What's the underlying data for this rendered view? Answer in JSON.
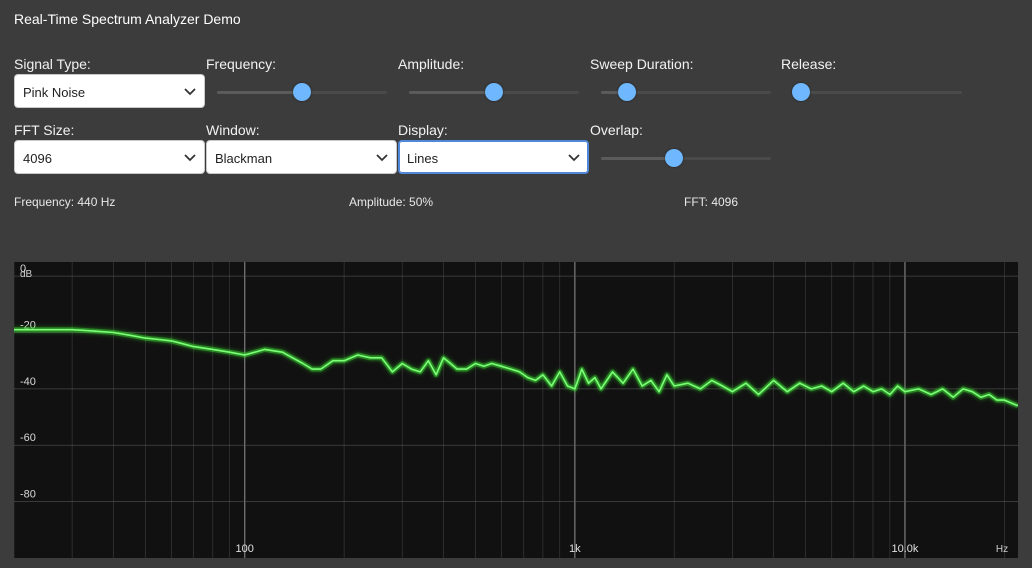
{
  "app": {
    "title": "Real-Time Spectrum Analyzer Demo"
  },
  "controls": {
    "signal_type": {
      "label": "Signal Type:",
      "value": "Pink Noise",
      "icon": "chevron-down-icon"
    },
    "frequency": {
      "label": "Frequency:",
      "level": 0.5
    },
    "amplitude": {
      "label": "Amplitude:",
      "level": 0.5
    },
    "sweep_duration": {
      "label": "Sweep Duration:",
      "level": 0.15
    },
    "release": {
      "label": "Release:",
      "level": 0.05
    },
    "fft_size": {
      "label": "FFT Size:",
      "value": "4096",
      "icon": "chevron-down-icon"
    },
    "window": {
      "label": "Window:",
      "value": "Blackman",
      "icon": "chevron-down-icon"
    },
    "display": {
      "label": "Display:",
      "value": "Lines",
      "icon": "chevron-down-icon"
    },
    "overlap": {
      "label": "Overlap:",
      "level": 0.43
    }
  },
  "status": {
    "frequency": "Frequency: 440 Hz",
    "amplitude": "Amplitude: 50%",
    "fft": "FFT: 4096"
  },
  "colors": {
    "background": "#3c3c3c",
    "plot_background": "#111111",
    "slider_thumb": "#6fb7ff",
    "spectrum_line": "#7dff7a",
    "grid": "#5a5a5a",
    "focus": "#4f87d9"
  },
  "chart_data": {
    "type": "line",
    "xscale": "log",
    "xlabel": "Hz",
    "ylabel": "dB",
    "xlim": [
      20,
      22000
    ],
    "ylim": [
      -100,
      5
    ],
    "yticks": [
      0,
      -20,
      -40,
      -60,
      -80
    ],
    "ytick_labels": [
      "0",
      "-20",
      "-40",
      "-60",
      "-80"
    ],
    "xticks": [
      100,
      1000,
      10000
    ],
    "xtick_labels": [
      "100",
      "1k",
      "10.0k"
    ],
    "grid": true,
    "series": [
      {
        "x": [
          20,
          25,
          30,
          35,
          40,
          45,
          50,
          55,
          60,
          65,
          70,
          80,
          90,
          100,
          115,
          130,
          150,
          160,
          170,
          185,
          200,
          220,
          240,
          260,
          280,
          300,
          320,
          340,
          360,
          380,
          400,
          420,
          440,
          470,
          500,
          530,
          560,
          600,
          640,
          680,
          720,
          760,
          800,
          850,
          900,
          950,
          1000,
          1050,
          1100,
          1150,
          1200,
          1300,
          1400,
          1500,
          1600,
          1700,
          1800,
          1900,
          2000,
          2200,
          2400,
          2600,
          2800,
          3000,
          3300,
          3600,
          4000,
          4400,
          4800,
          5200,
          5600,
          6000,
          6500,
          7000,
          7500,
          8000,
          8500,
          9000,
          9500,
          10000,
          11000,
          12000,
          13000,
          14000,
          15000,
          16000,
          17000,
          18000,
          19000,
          20000,
          21000,
          22000
        ],
        "y": [
          -19,
          -19,
          -19,
          -19.5,
          -20,
          -21,
          -22,
          -22.5,
          -23,
          -24,
          -25,
          -26,
          -27,
          -28,
          -26,
          -27,
          -31,
          -33,
          -33,
          -30,
          -30,
          -28,
          -29,
          -29,
          -34,
          -31,
          -33,
          -34,
          -30,
          -35,
          -29,
          -31,
          -33,
          -33,
          -31,
          -32,
          -31,
          -32,
          -33,
          -34,
          -36,
          -37,
          -35,
          -39,
          -34,
          -39,
          -40,
          -33,
          -38,
          -36,
          -40,
          -34,
          -38,
          -33,
          -39,
          -37,
          -41,
          -35,
          -39,
          -38,
          -40,
          -37,
          -39,
          -41,
          -38,
          -42,
          -37,
          -41,
          -38,
          -40,
          -39,
          -41,
          -38,
          -41,
          -39,
          -41,
          -40,
          -42,
          -39,
          -41,
          -40,
          -42,
          -40,
          -43,
          -40,
          -41,
          -43,
          -42,
          -44,
          -44,
          -45,
          -46
        ]
      }
    ]
  }
}
